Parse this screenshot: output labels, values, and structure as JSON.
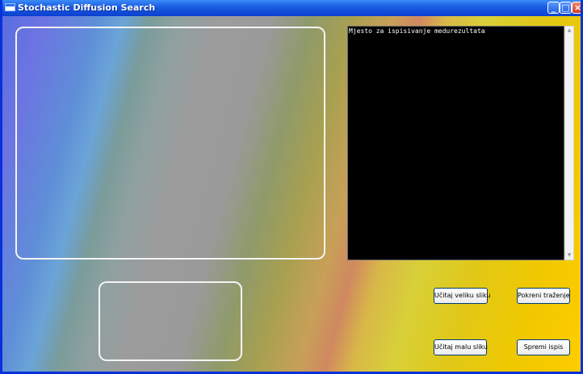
{
  "window": {
    "title": "Stochastic Diffusion Search",
    "app_icon": "window-icon",
    "controls": {
      "minimize_icon": "minimize-icon",
      "maximize_icon": "maximize-icon",
      "close_icon": "close-icon"
    }
  },
  "console": {
    "text": "Mjesto za ispisivanje medurezultata"
  },
  "buttons": {
    "load_big": "Učitaj veliku sliku",
    "start_search": "Pokreni traženje",
    "load_small": "Učitaj malu sliku",
    "save_output": "Spremi ispis"
  },
  "colors": {
    "titlebar": "#0a3fd0",
    "console_bg": "#000000",
    "console_text": "#ffffff",
    "frame_border": "#f4f4f4"
  }
}
